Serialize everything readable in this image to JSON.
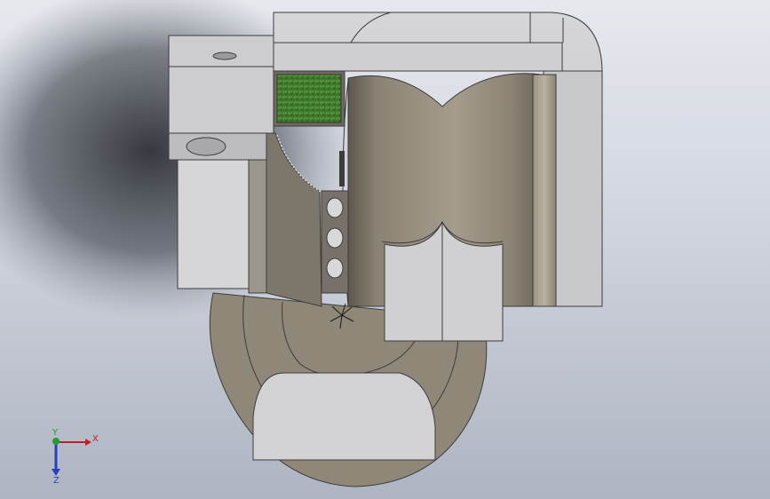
{
  "triad": {
    "x_label": "X",
    "y_label": "Y",
    "z_label": "Z",
    "x_color": "#c0202a",
    "y_color": "#1fa030",
    "z_color": "#2a3fc0"
  },
  "colors": {
    "grey_body": "#c8c8ca",
    "grey_light": "#dcdcde",
    "grey_dark": "#a6a6aa",
    "concrete": "#8c8578",
    "concrete_light": "#a39c8e",
    "concrete_dark": "#5e584e",
    "grass": "#3f7a2c",
    "grass_light": "#5d9b3c",
    "edge": "#3c3c3c"
  }
}
